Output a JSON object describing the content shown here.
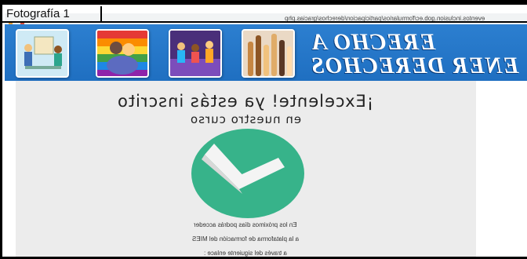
{
  "caption": "Fotografía 1",
  "browser": {
    "url": "eventos.inclusion.gob.ec/formularios/participacion/derechos/gracias.php"
  },
  "banner": {
    "line1": "ERECHO A",
    "line2": "ENER DERECHOS",
    "thumbnails": [
      "meeting-illustration",
      "rainbow-embrace-illustration",
      "support-group-illustration",
      "raised-hands-illustration"
    ]
  },
  "content": {
    "headline": "¡Excelente! ya estás inscrito",
    "subheadline": "en nuestro curso",
    "body_lines": [
      "En los próximos días podrás acceder",
      "a la plataforma de formación del MIES",
      "a través del siguiente enlace :"
    ]
  },
  "colors": {
    "banner_blue": "#2c7fd0",
    "check_green": "#37b38a",
    "panel_gray": "#ececec"
  }
}
